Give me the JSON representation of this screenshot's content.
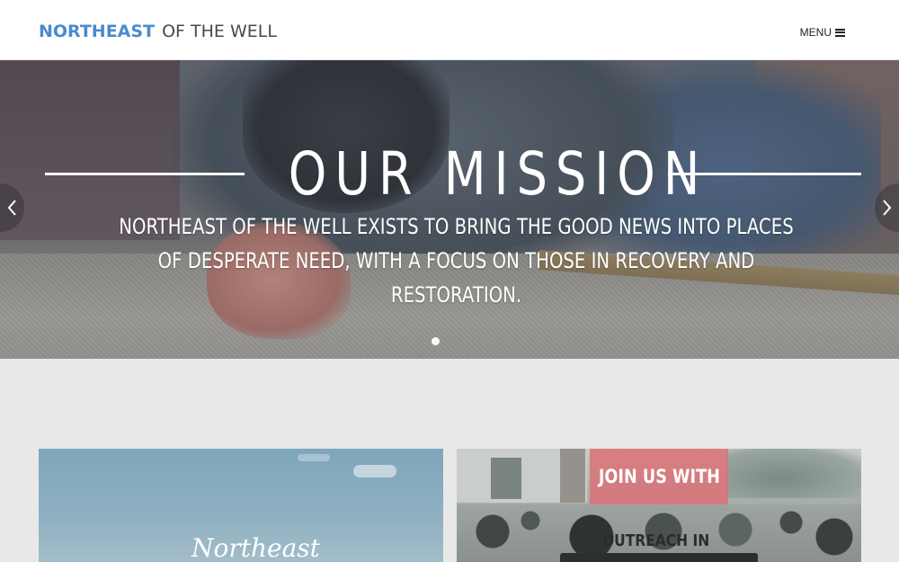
{
  "header": {
    "logo_strong": "NORTHEAST",
    "logo_light": "OF THE WELL",
    "menu_label": "MENU",
    "menu_icon": "hamburger-icon",
    "logo_color": "#4a8ad1"
  },
  "hero": {
    "title": "OUR MISSION",
    "text": "NORTHEAST OF THE WELL EXISTS TO BRING THE GOOD NEWS INTO PLACES OF DESPERATE NEED, WITH A FOCUS ON THOSE IN RECOVERY AND RESTORATION.",
    "prev_icon": "chevron-left-icon",
    "next_icon": "chevron-right-icon",
    "slide_count": 1,
    "active_slide": 1
  },
  "cards": {
    "left": {
      "script_text": "Northeast"
    },
    "right": {
      "banner_text": "JOIN US WITH",
      "subtitle": "OUTREACH IN",
      "banner_color": "#dc6e73"
    }
  }
}
